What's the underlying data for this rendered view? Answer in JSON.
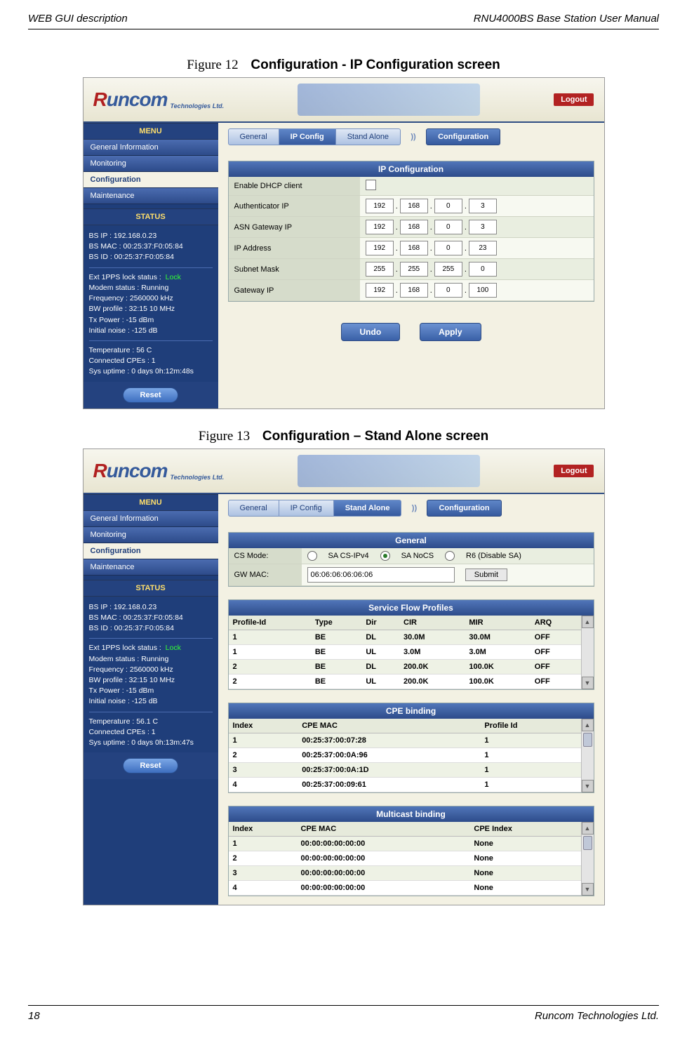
{
  "header": {
    "left": "WEB GUI description",
    "right": "RNU4000BS Base Station User Manual"
  },
  "footer": {
    "left": "18",
    "right": "Runcom Technologies Ltd."
  },
  "captions": {
    "fig12_lead": "Figure 12",
    "fig12_bold": "Configuration - IP Configuration screen",
    "fig13_lead": "Figure 13",
    "fig13_bold": "Configuration – Stand Alone screen"
  },
  "common": {
    "logo_main": "Runcom",
    "logo_sub": "Technologies Ltd.",
    "logout": "Logout",
    "menu_header": "MENU",
    "status_header": "STATUS",
    "reset": "Reset",
    "menu_items": [
      "General Information",
      "Monitoring",
      "Configuration",
      "Maintenance"
    ],
    "tabs": [
      "General",
      "IP Config",
      "Stand Alone"
    ],
    "crumb": "Configuration"
  },
  "fig12": {
    "active_tab": "IP Config",
    "panel_title": "IP Configuration",
    "fields": {
      "enable_dhcp": "Enable DHCP client",
      "auth_ip": "Authenticator IP",
      "asn_gw": "ASN Gateway IP",
      "ip_addr": "IP Address",
      "subnet": "Subnet Mask",
      "gw_ip": "Gateway IP"
    },
    "values": {
      "auth_ip": [
        "192",
        "168",
        "0",
        "3"
      ],
      "asn_gw": [
        "192",
        "168",
        "0",
        "3"
      ],
      "ip_addr": [
        "192",
        "168",
        "0",
        "23"
      ],
      "subnet": [
        "255",
        "255",
        "255",
        "0"
      ],
      "gw_ip": [
        "192",
        "168",
        "0",
        "100"
      ]
    },
    "buttons": {
      "undo": "Undo",
      "apply": "Apply"
    },
    "status": {
      "bs_ip": "BS IP :  192.168.0.23",
      "bs_mac": "BS MAC :  00:25:37:F0:05:84",
      "bs_id": "BS ID :  00:25:37:F0:05:84",
      "oneppsl": "Ext 1PPS lock status :",
      "onepps_val": "Lock",
      "modem": "Modem status :  Running",
      "freq": "Frequency :  2560000 kHz",
      "bw": "BW profile :  32:15 10 MHz",
      "txp": "Tx Power :  -15 dBm",
      "inoise": "Initial noise :  -125 dB",
      "temp": "Temperature :  56 C",
      "cpes": "Connected CPEs :  1",
      "uptime": "Sys uptime :  0 days 0h:12m:48s"
    }
  },
  "fig13": {
    "active_tab": "Stand Alone",
    "general_panel": "General",
    "cs_mode_label": "CS Mode:",
    "cs_mode_opts": [
      "SA CS-IPv4",
      "SA NoCS",
      "R6 (Disable SA)"
    ],
    "cs_mode_selected": 1,
    "gw_mac_label": "GW MAC:",
    "gw_mac_value": "06:06:06:06:06:06",
    "submit": "Submit",
    "sfp_panel": "Service Flow Profiles",
    "sfp_headers": [
      "Profile-Id",
      "Type",
      "Dir",
      "CIR",
      "MIR",
      "ARQ"
    ],
    "sfp_rows": [
      [
        "1",
        "BE",
        "DL",
        "30.0M",
        "30.0M",
        "OFF"
      ],
      [
        "1",
        "BE",
        "UL",
        "3.0M",
        "3.0M",
        "OFF"
      ],
      [
        "2",
        "BE",
        "DL",
        "200.0K",
        "100.0K",
        "OFF"
      ],
      [
        "2",
        "BE",
        "UL",
        "200.0K",
        "100.0K",
        "OFF"
      ]
    ],
    "cpe_panel": "CPE binding",
    "cpe_headers": [
      "Index",
      "CPE MAC",
      "Profile Id"
    ],
    "cpe_rows": [
      [
        "1",
        "00:25:37:00:07:28",
        "1"
      ],
      [
        "2",
        "00:25:37:00:0A:96",
        "1"
      ],
      [
        "3",
        "00:25:37:00:0A:1D",
        "1"
      ],
      [
        "4",
        "00:25:37:00:09:61",
        "1"
      ]
    ],
    "mc_panel": "Multicast binding",
    "mc_headers": [
      "Index",
      "CPE MAC",
      "CPE Index"
    ],
    "mc_rows": [
      [
        "1",
        "00:00:00:00:00:00",
        "None"
      ],
      [
        "2",
        "00:00:00:00:00:00",
        "None"
      ],
      [
        "3",
        "00:00:00:00:00:00",
        "None"
      ],
      [
        "4",
        "00:00:00:00:00:00",
        "None"
      ]
    ],
    "status": {
      "bs_ip": "BS IP :  192.168.0.23",
      "bs_mac": "BS MAC :  00:25:37:F0:05:84",
      "bs_id": "BS ID :  00:25:37:F0:05:84",
      "oneppsl": "Ext 1PPS lock status :",
      "onepps_val": "Lock",
      "modem": "Modem status :  Running",
      "freq": "Frequency :  2560000 kHz",
      "bw": "BW profile :  32:15 10 MHz",
      "txp": "Tx Power :  -15 dBm",
      "inoise": "Initial noise :  -125 dB",
      "temp": "Temperature :  56.1 C",
      "cpes": "Connected CPEs :  1",
      "uptime": "Sys uptime :  0 days 0h:13m:47s"
    }
  }
}
